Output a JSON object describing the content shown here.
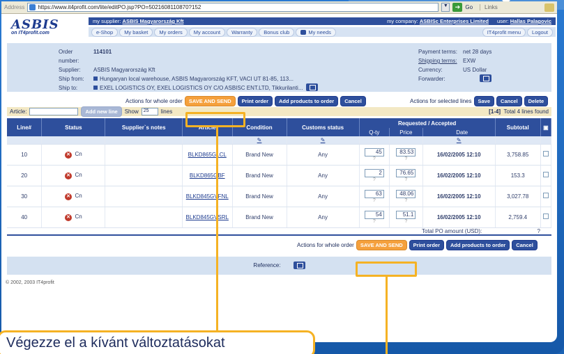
{
  "browser": {
    "address_label": "Address",
    "url": "https://www.it4profit.com/lite/editPO.jsp?PO=5021608110870?152",
    "go_label": "Go",
    "links_label": "Links"
  },
  "header": {
    "logo_main": "ASBIS",
    "logo_sub": "on IT4profit.com",
    "supplier_label": "my supplier:",
    "supplier_value": "ASBIS Magyarország Kft",
    "company_label": "my company:",
    "company_value": "ASBISc Enterprises Limited",
    "user_label": "user:",
    "user_value": "Hallas Palagovic",
    "nav": [
      "e-Shop",
      "My basket",
      "My orders",
      "My account",
      "Warranty",
      "Bonus club",
      "My needs"
    ],
    "nav_right": [
      "IT4profit menu",
      "Logout"
    ]
  },
  "order": {
    "number_label": "Order number:",
    "number": "114101",
    "supplier_label": "Supplier:",
    "supplier": "ASBIS Magyarország Kft",
    "ship_from_label": "Ship from:",
    "ship_from": "Hungaryan local warehouse, ASBIS Magyarország KFT, VACI UT 81-85, 113...",
    "ship_to_label": "Ship to:",
    "ship_to": "EXEL LOGISTICS OY, EXEL LOGISTICS OY C/O ASBISC ENT.LTD, Tikkurilanti...",
    "payment_label": "Payment terms:",
    "payment": "net 28 days",
    "shipping_label": "Shipping terms:",
    "shipping": "EXW",
    "currency_label": "Currency:",
    "currency": "US Dollar",
    "forwarder_label": "Forwarder:"
  },
  "actions": {
    "whole_label": "Actions for whole order",
    "save_send": "SAVE AND SEND",
    "print": "Print order",
    "add_products": "Add products to order",
    "cancel": "Cancel",
    "selected_label": "Actions for selected lines",
    "save": "Save",
    "cancel_sel": "Cancel",
    "delete": "Delete"
  },
  "filter": {
    "article_label": "Article:",
    "add_line": "Add new line",
    "show_label": "Show",
    "show_value": "25",
    "lines_label": "lines",
    "range": "[1-4]",
    "total_found": "Total 4 lines found"
  },
  "table": {
    "headers": [
      "Line#",
      "Status",
      "Supplier`s notes",
      "Article",
      "Condition",
      "Customs status",
      "Requested / Accepted",
      "Subtotal"
    ],
    "sub_headers": [
      "Q-ty",
      "Price",
      "Date"
    ],
    "rows": [
      {
        "line": "10",
        "status": "Cn",
        "article": "BLKD865GLCL",
        "condition": "Brand New",
        "customs": "Any",
        "qty": "45",
        "price": "83.53",
        "date": "16/02/2005 12:10",
        "subtotal": "3,758.85"
      },
      {
        "line": "20",
        "status": "Cn",
        "article": "BLKD865GBF",
        "condition": "Brand New",
        "customs": "Any",
        "qty": "2",
        "price": "76.65",
        "date": "16/02/2005 12:10",
        "subtotal": "153.3"
      },
      {
        "line": "30",
        "status": "Cn",
        "article": "BLKD845GVFNL",
        "condition": "Brand New",
        "customs": "Any",
        "qty": "63",
        "price": "48.06",
        "date": "16/02/2005 12:10",
        "subtotal": "3,027.78"
      },
      {
        "line": "40",
        "status": "Cn",
        "article": "BLKD845GVSRL",
        "condition": "Brand New",
        "customs": "Any",
        "qty": "54",
        "price": "51.1",
        "date": "16/02/2005 12:10",
        "subtotal": "2,759.4"
      }
    ],
    "total_label": "Total PO amount (USD):",
    "total_value": "?"
  },
  "reference_label": "Reference:",
  "copyright": "© 2002, 2003 IT4profit",
  "callout": "Végezze el a kívánt változtatásokat",
  "colors": {
    "accent": "#2e4f9c",
    "highlight": "#f5b224",
    "save_send": "#f5a03c"
  }
}
